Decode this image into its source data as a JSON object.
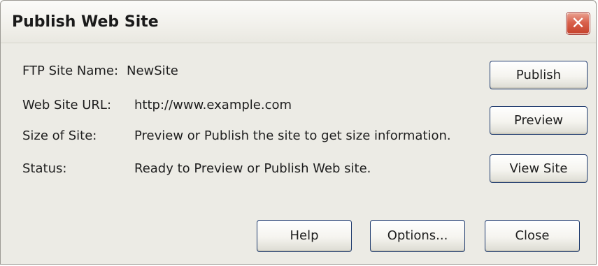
{
  "window": {
    "title": "Publish Web Site",
    "close_glyph": "✕"
  },
  "fields": [
    {
      "label": "FTP Site Name:",
      "value": "NewSite"
    },
    {
      "label": "Web Site URL:",
      "value": "http://www.example.com"
    },
    {
      "label": "Size of Site:",
      "value": "Preview or Publish the site to get size information."
    },
    {
      "label": "Status:",
      "value": "Ready to Preview or Publish Web site."
    }
  ],
  "side_buttons": {
    "publish": "Publish",
    "preview": "Preview",
    "view_site": "View Site"
  },
  "bottom_buttons": {
    "help": "Help",
    "options": "Options...",
    "close": "Close"
  },
  "colors": {
    "dialog_background": "#ecebe5",
    "close_button_red": "#c6432d",
    "button_border": "#1f3b6e"
  }
}
